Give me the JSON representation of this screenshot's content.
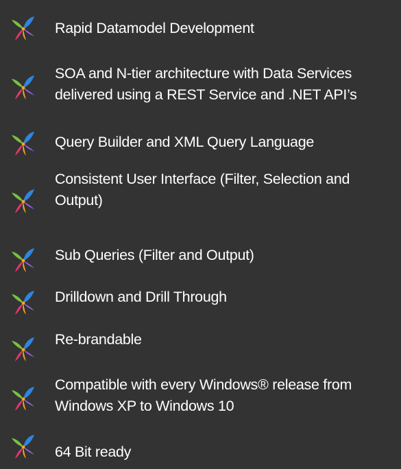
{
  "features": [
    "Rapid Datamodel Development",
    "SOA and N-tier architecture with Data Services delivered using a REST Service and .NET API’s",
    "Query Builder and XML Query Language",
    "Consistent User Interface (Filter, Selection and Output)",
    "Sub Queries (Filter and Output)",
    "Drilldown and Drill Through",
    "Re-brandable",
    "Compatible with every Windows® release from Windows XP to Windows 10",
    "64 Bit ready"
  ],
  "icon": {
    "name": "pinwheel-bullet-icon",
    "colors": {
      "top_right": "#2e86de",
      "top_left": "#7bc043",
      "bottom_left": "#e8356d",
      "bottom_right": "#9b5de5",
      "center": "#f5a623"
    }
  },
  "colors": {
    "background": "#333333",
    "text": "#ffffff"
  }
}
